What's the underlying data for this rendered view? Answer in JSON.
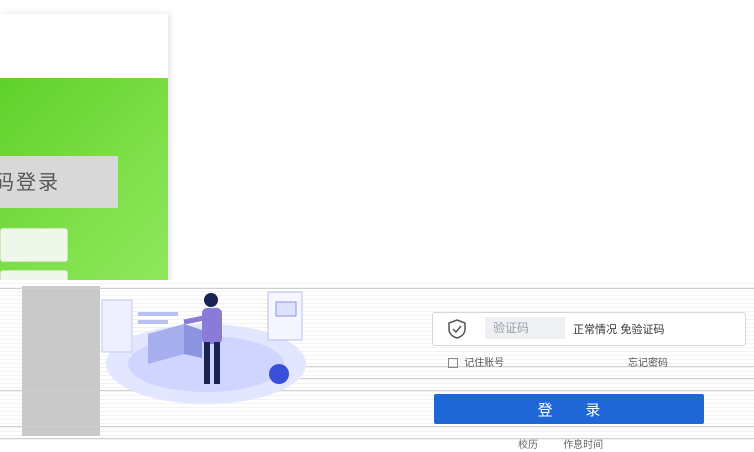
{
  "login_tabs": {
    "active_tab_label": "码登录"
  },
  "captcha": {
    "placeholder": "验证码",
    "hint": "正常情况 免验证码"
  },
  "remember_account_label": "记住账号",
  "forgot_password_label": "忘记密码",
  "login_button_label": "登 录",
  "footer": {
    "link1": "校历",
    "link2": "作息时间"
  },
  "colors": {
    "brand_green": "#6ad630",
    "primary_button": "#1f66d6",
    "tab_gray": "#d8d8d8",
    "illustration_purple": "#8a7bd8"
  },
  "icons": [
    "shield-icon",
    "checkbox-icon"
  ]
}
